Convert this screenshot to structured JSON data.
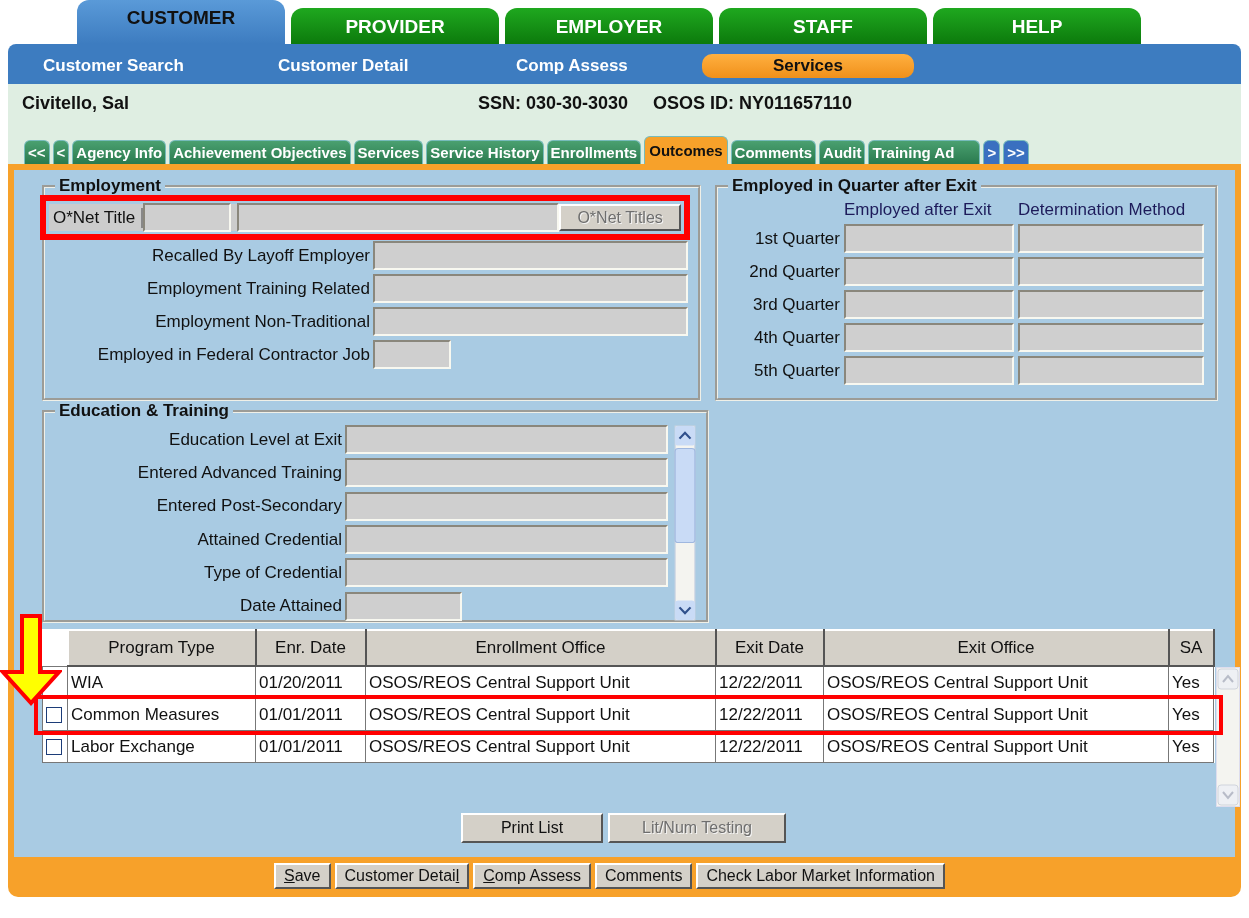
{
  "top_tabs": [
    {
      "label": "CUSTOMER",
      "selected": true
    },
    {
      "label": "PROVIDER",
      "selected": false
    },
    {
      "label": "EMPLOYER",
      "selected": false
    },
    {
      "label": "STAFF",
      "selected": false
    },
    {
      "label": "HELP",
      "selected": false
    }
  ],
  "sub_nav": [
    {
      "label": "Customer Search",
      "selected": false
    },
    {
      "label": "Customer Detail",
      "selected": false
    },
    {
      "label": "Comp Assess",
      "selected": false
    },
    {
      "label": "Services",
      "selected": true
    }
  ],
  "customer": {
    "name": "Civitello, Sal",
    "ssn": "SSN: 030-30-3030",
    "osos_id": "OSOS ID: NY011657110"
  },
  "record_tabs": {
    "nav_left": [
      "<<",
      "<"
    ],
    "nav_right": [
      ">",
      ">>"
    ],
    "tabs": [
      {
        "label": "Agency Info",
        "selected": false
      },
      {
        "label": "Achievement Objectives",
        "selected": false
      },
      {
        "label": "Services",
        "selected": false
      },
      {
        "label": "Service History",
        "selected": false
      },
      {
        "label": "Enrollments",
        "selected": false
      },
      {
        "label": "Outcomes",
        "selected": true
      },
      {
        "label": "Comments",
        "selected": false
      },
      {
        "label": "Audit",
        "selected": false
      },
      {
        "label": "Training Ad",
        "selected": false
      }
    ]
  },
  "employment": {
    "title": "Employment",
    "onet": {
      "label": "O*Net Title",
      "button": "O*Net Titles",
      "button_disabled": true,
      "highlighted": true
    },
    "fields": [
      {
        "label": "Recalled By Layoff Employer",
        "kind": "wide"
      },
      {
        "label": "Employment Training Related",
        "kind": "wide"
      },
      {
        "label": "Employment Non-Traditional",
        "kind": "wide"
      },
      {
        "label": "Employed in Federal Contractor Job",
        "kind": "short"
      }
    ]
  },
  "quarters": {
    "title": "Employed in Quarter after Exit",
    "columns": [
      "Employed after Exit",
      "Determination Method"
    ],
    "rows": [
      "1st Quarter",
      "2nd Quarter",
      "3rd Quarter",
      "4th Quarter",
      "5th Quarter"
    ]
  },
  "education": {
    "title": "Education & Training",
    "fields": [
      {
        "label": "Education Level at Exit",
        "kind": "wide"
      },
      {
        "label": "Entered Advanced Training",
        "kind": "wide"
      },
      {
        "label": "Entered Post-Secondary",
        "kind": "wide"
      },
      {
        "label": "Attained Credential",
        "kind": "wide"
      },
      {
        "label": "Type of Credential",
        "kind": "wide"
      },
      {
        "label": "Date Attained",
        "kind": "short"
      }
    ]
  },
  "programs": {
    "columns": [
      "Program Type",
      "Enr. Date",
      "Enrollment Office",
      "Exit Date",
      "Exit Office",
      "SA"
    ],
    "rows": [
      {
        "pointer": true,
        "highlighted": false,
        "cells": [
          "WIA",
          "01/20/2011",
          "OSOS/REOS Central Support Unit",
          "12/22/2011",
          "OSOS/REOS Central Support Unit",
          "Yes"
        ]
      },
      {
        "checked": false,
        "pointer": false,
        "highlighted": true,
        "cells": [
          "Common Measures",
          "01/01/2011",
          "OSOS/REOS Central Support Unit",
          "12/22/2011",
          "OSOS/REOS Central Support Unit",
          "Yes"
        ]
      },
      {
        "checked": false,
        "pointer": false,
        "highlighted": false,
        "cells": [
          "Labor Exchange",
          "01/01/2011",
          "OSOS/REOS Central Support Unit",
          "12/22/2011",
          "OSOS/REOS Central Support Unit",
          "Yes"
        ]
      }
    ]
  },
  "list_buttons": [
    {
      "label": "Print List",
      "disabled": false
    },
    {
      "label": "Lit/Num Testing",
      "disabled": true
    }
  ],
  "footer_buttons": [
    {
      "parts": [
        {
          "text": "S",
          "underlined": true
        },
        {
          "text": "ave",
          "underlined": false
        }
      ]
    },
    {
      "parts": [
        {
          "text": "Customer Detai",
          "underlined": false
        },
        {
          "text": "l",
          "underlined": true
        }
      ]
    },
    {
      "parts": [
        {
          "text": "C",
          "underlined": true
        },
        {
          "text": "omp Assess",
          "underlined": false
        }
      ]
    },
    {
      "parts": [
        {
          "text": "Comments",
          "underlined": false
        }
      ]
    },
    {
      "parts": [
        {
          "text": "Check Labor Market Information",
          "underlined": false
        }
      ]
    }
  ]
}
